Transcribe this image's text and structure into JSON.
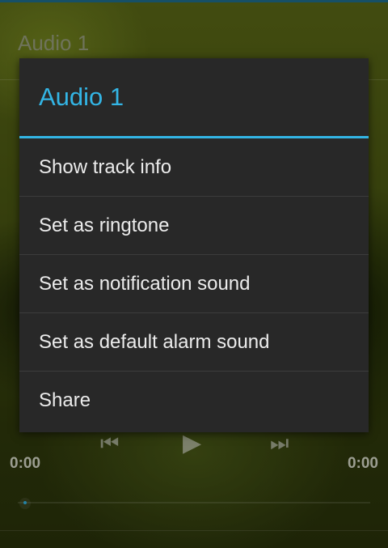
{
  "header": {
    "title": "Audio 1"
  },
  "player": {
    "prev_icon": "skip-previous-icon",
    "play_icon": "play-icon",
    "next_icon": "skip-next-icon",
    "elapsed": "0:00",
    "duration": "0:00",
    "progress": 0
  },
  "dialog": {
    "title": "Audio 1",
    "accent": "#33b5e5",
    "items": [
      {
        "label": "Show track info"
      },
      {
        "label": "Set as ringtone"
      },
      {
        "label": "Set as notification sound"
      },
      {
        "label": "Set as default alarm sound"
      },
      {
        "label": "Share"
      }
    ]
  }
}
